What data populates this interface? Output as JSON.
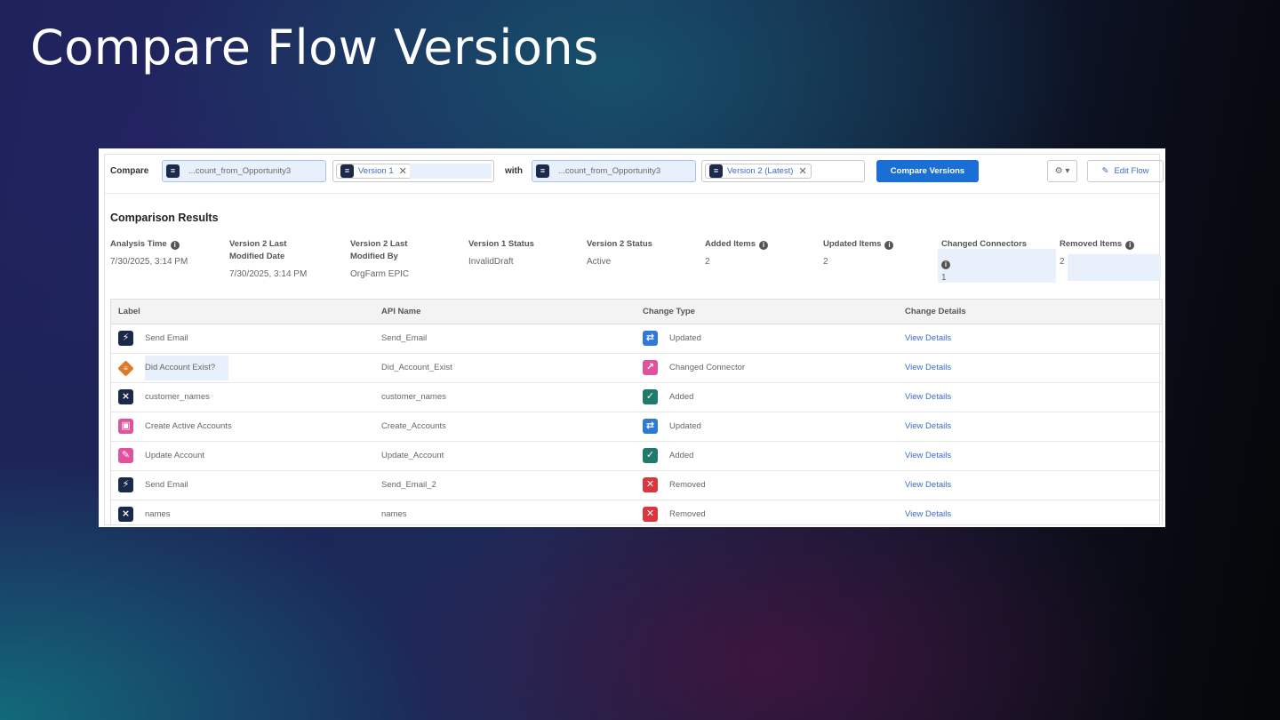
{
  "slide_title": "Compare Flow Versions",
  "toolbar": {
    "compare_label": "Compare",
    "flow_a": "...count_from_Opportunity3",
    "version_a": "Version 1",
    "with_label": "with",
    "flow_b": "...count_from_Opportunity3",
    "version_b": "Version 2 (Latest)",
    "compare_button": "Compare Versions",
    "gear_menu": "⚙ ▾",
    "edit_flow_button": "Edit Flow"
  },
  "results": {
    "title": "Comparison Results",
    "stats": [
      {
        "label1": "Analysis Time",
        "label2": "",
        "value": "7/30/2025, 3:14 PM",
        "info": true
      },
      {
        "label1": "Version 2 Last",
        "label2": "Modified Date",
        "value": "7/30/2025, 3:14 PM",
        "info": false
      },
      {
        "label1": "Version 2 Last",
        "label2": "Modified By",
        "value": "OrgFarm EPIC",
        "info": false
      },
      {
        "label1": "Version 1 Status",
        "label2": "",
        "value": "InvalidDraft",
        "info": false
      },
      {
        "label1": "Version 2 Status",
        "label2": "",
        "value": "Active",
        "info": false
      },
      {
        "label1": "Added Items",
        "label2": "",
        "value": "2",
        "info": true
      },
      {
        "label1": "Updated Items",
        "label2": "",
        "value": "2",
        "info": true
      },
      {
        "label1": "Changed Connectors",
        "label2": "",
        "value": "1",
        "info": false
      },
      {
        "label1": "Removed Items",
        "label2": "",
        "value": "2",
        "info": true
      }
    ]
  },
  "table": {
    "headers": [
      "Label",
      "API Name",
      "Change Type",
      "Change Details"
    ],
    "rows": [
      {
        "label": "Send Email",
        "api": "Send_Email",
        "change": "Updated",
        "details": "View Details"
      },
      {
        "label": "Did Account Exist?",
        "api": "Did_Account_Exist",
        "change": "Changed Connector",
        "details": "View Details"
      },
      {
        "label": "customer_names",
        "api": "customer_names",
        "change": "Added",
        "details": "View Details"
      },
      {
        "label": "Create Active Accounts",
        "api": "Create_Accounts",
        "change": "Updated",
        "details": "View Details"
      },
      {
        "label": "Update Account",
        "api": "Update_Account",
        "change": "Added",
        "details": "View Details"
      },
      {
        "label": "Send Email",
        "api": "Send_Email_2",
        "change": "Removed",
        "details": "View Details"
      },
      {
        "label": "names",
        "api": "names",
        "change": "Removed",
        "details": "View Details"
      }
    ]
  },
  "icons": {
    "element_icons": [
      "action-icon",
      "decision-icon",
      "assignment-icon",
      "create-records-icon",
      "update-records-icon",
      "action-icon",
      "assignment-icon"
    ],
    "change_icons": [
      "updated-icon",
      "changed-connector-icon",
      "added-icon",
      "updated-icon",
      "added-icon",
      "removed-icon",
      "removed-icon"
    ]
  },
  "colors": {
    "primary_button": "#1a6fd6",
    "link": "#3b6dc2",
    "updated": "#2f7ad6",
    "changed_connector": "#e0529c",
    "added": "#1f7a6b",
    "removed": "#d9363e",
    "decision": "#dd7a2a",
    "record": "#e0529c",
    "action_dark": "#1b2a4a"
  }
}
